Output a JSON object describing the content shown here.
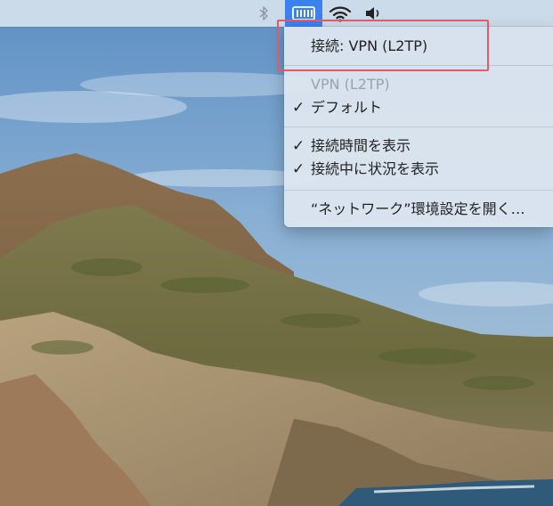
{
  "menubar": {
    "icons": [
      "bluetooth-icon",
      "vpn-status-icon",
      "wifi-icon",
      "volume-icon"
    ],
    "vpn_active_color": "#3b82f0"
  },
  "vpn_menu": {
    "connect_label": "接続: VPN (L2TP)",
    "config_header": "VPN (L2TP)",
    "default_label": "デフォルト",
    "show_time_label": "接続時間を表示",
    "show_status_label": "接続中に状況を表示",
    "open_prefs_label": "“ネットワーク”環境設定を開く…",
    "default_checked": true,
    "show_time_checked": true,
    "show_status_checked": true,
    "checkmark": "✓"
  },
  "annotation": {
    "highlight_color": "#e05a6a"
  }
}
